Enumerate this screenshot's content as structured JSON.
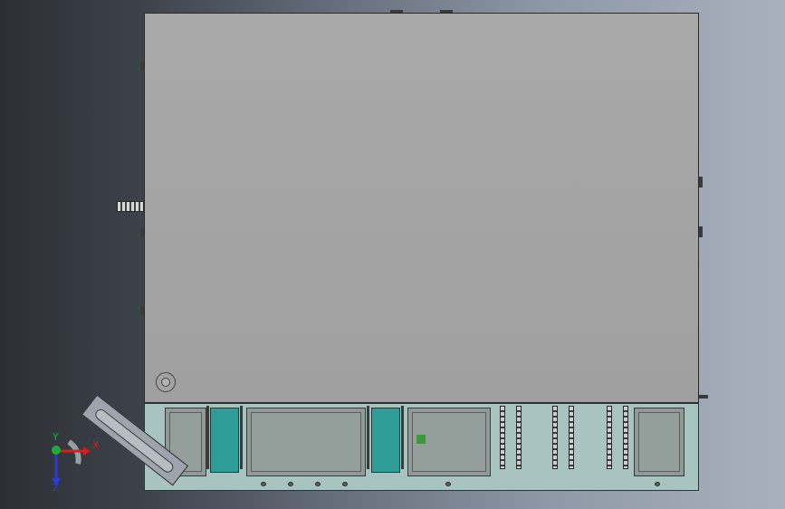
{
  "viewport": {
    "background_left": "#2c2f35",
    "background_right": "#a9b1bd",
    "cover_color": "#a7a7a7",
    "base_color": "#a9c4c0",
    "module_accent": "#2e9c97"
  },
  "triad": {
    "x_label": "X",
    "y_label": "Y",
    "z_label": "Z",
    "x_color": "#d21f1f",
    "y_color": "#1faa3a",
    "z_color": "#2b3ccf"
  },
  "icons": {
    "coordinate_triad": "triad-icon",
    "knob": "circle-knob-icon"
  }
}
